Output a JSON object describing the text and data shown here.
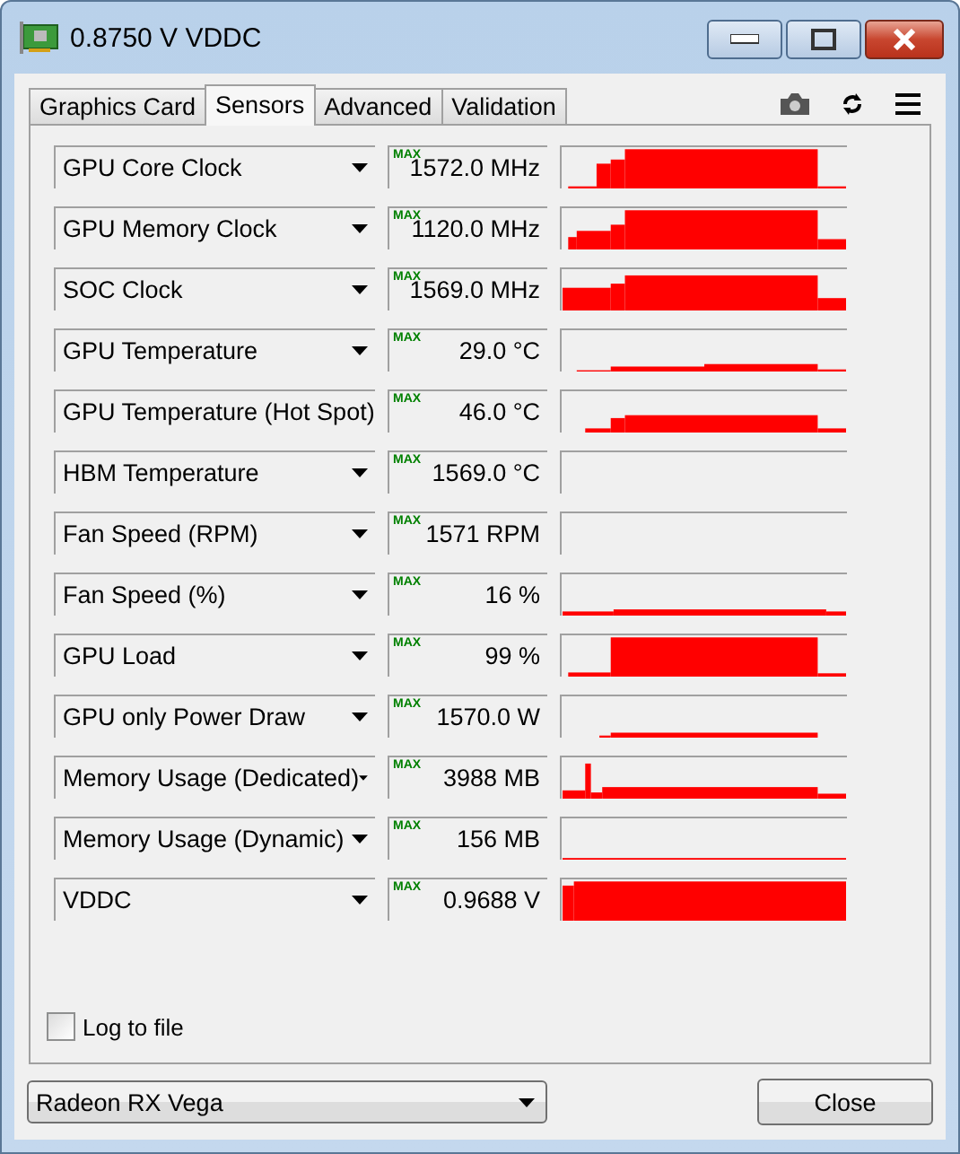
{
  "window": {
    "title": "0.8750 V VDDC"
  },
  "tabs": [
    {
      "label": "Graphics Card",
      "selected": false
    },
    {
      "label": "Sensors",
      "selected": true
    },
    {
      "label": "Advanced",
      "selected": false
    },
    {
      "label": "Validation",
      "selected": false
    }
  ],
  "sensors": [
    {
      "name": "GPU Core Clock",
      "mode": "MAX",
      "value": "1572.0 MHz"
    },
    {
      "name": "GPU Memory Clock",
      "mode": "MAX",
      "value": "1120.0 MHz"
    },
    {
      "name": "SOC Clock",
      "mode": "MAX",
      "value": "1569.0 MHz"
    },
    {
      "name": "GPU Temperature",
      "mode": "MAX",
      "value": "29.0 °C"
    },
    {
      "name": "GPU Temperature (Hot Spot)",
      "mode": "MAX",
      "value": "46.0 °C"
    },
    {
      "name": "HBM Temperature",
      "mode": "MAX",
      "value": "1569.0 °C"
    },
    {
      "name": "Fan Speed (RPM)",
      "mode": "MAX",
      "value": "1571 RPM"
    },
    {
      "name": "Fan Speed (%)",
      "mode": "MAX",
      "value": "16 %"
    },
    {
      "name": "GPU Load",
      "mode": "MAX",
      "value": "99 %"
    },
    {
      "name": "GPU only Power Draw",
      "mode": "MAX",
      "value": "1570.0 W"
    },
    {
      "name": "Memory Usage (Dedicated)",
      "mode": "MAX",
      "value": "3988 MB"
    },
    {
      "name": "Memory Usage (Dynamic)",
      "mode": "MAX",
      "value": "156 MB"
    },
    {
      "name": "VDDC",
      "mode": "MAX",
      "value": "0.9688 V"
    }
  ],
  "log_to_file": {
    "label": "Log to file",
    "checked": false
  },
  "device_select": {
    "value": "Radeon RX Vega"
  },
  "close_button": {
    "label": "Close"
  }
}
